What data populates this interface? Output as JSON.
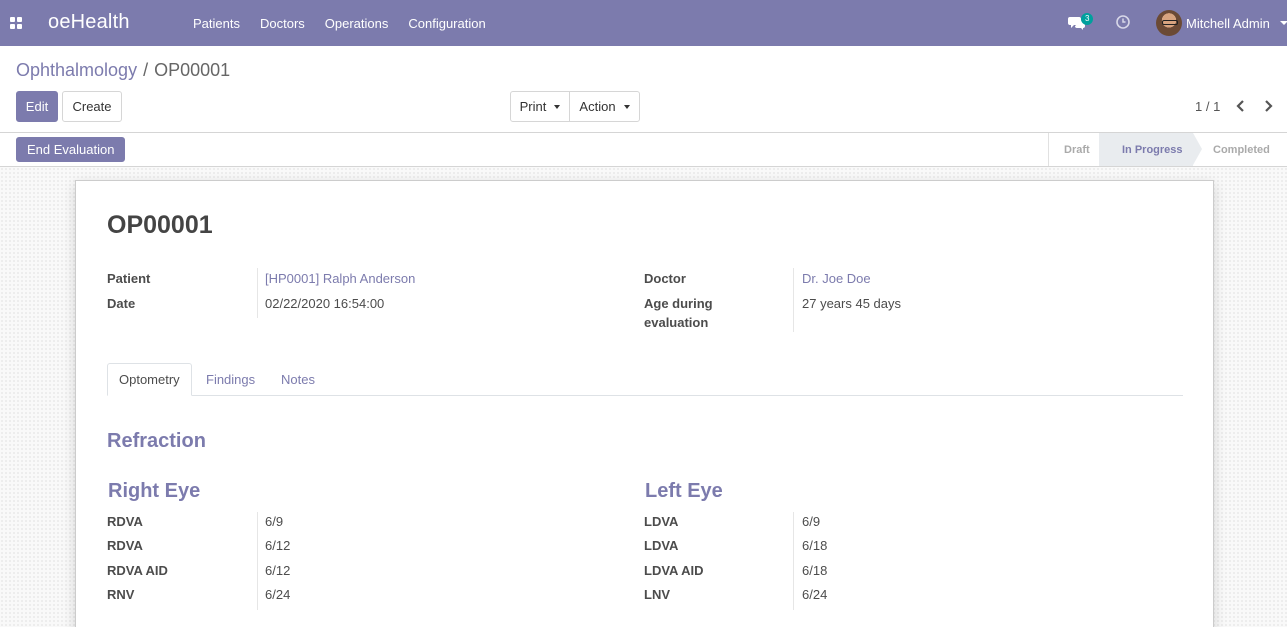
{
  "navbar": {
    "brand": "oeHealth",
    "menu": [
      "Patients",
      "Doctors",
      "Operations",
      "Configuration"
    ],
    "chat_count": "3",
    "user_name": "Mitchell Admin"
  },
  "breadcrumb": {
    "parent": "Ophthalmology",
    "separator": "/",
    "current": "OP00001"
  },
  "buttons": {
    "edit": "Edit",
    "create": "Create",
    "print": "Print",
    "action": "Action",
    "end_evaluation": "End Evaluation"
  },
  "pager": {
    "value": "1 / 1"
  },
  "stages": [
    "Draft",
    "In Progress",
    "Completed"
  ],
  "active_stage": "In Progress",
  "record": {
    "title": "OP00001",
    "fields_left": [
      {
        "label": "Patient",
        "value": "[HP0001] Ralph Anderson"
      },
      {
        "label": "Date",
        "value": "02/22/2020 16:54:00"
      }
    ],
    "fields_right": [
      {
        "label": "Doctor",
        "value": "Dr. Joe Doe"
      },
      {
        "label": "Age during",
        "label2": "evaluation",
        "value": "27 years 45 days"
      }
    ]
  },
  "tabs": [
    "Optometry",
    "Findings",
    "Notes"
  ],
  "active_tab": "Optometry",
  "optometry": {
    "section_title": "Refraction",
    "right_eye": {
      "title": "Right Eye",
      "rows": [
        {
          "label": "RDVA",
          "value": "6/9"
        },
        {
          "label": "RDVA",
          "value": "6/12"
        },
        {
          "label": "RDVA AID",
          "value": "6/12"
        },
        {
          "label": "RNV",
          "value": "6/24"
        }
      ]
    },
    "left_eye": {
      "title": "Left Eye",
      "rows": [
        {
          "label": "LDVA",
          "value": "6/9"
        },
        {
          "label": "LDVA",
          "value": "6/18"
        },
        {
          "label": "LDVA AID",
          "value": "6/18"
        },
        {
          "label": "LNV",
          "value": "6/24"
        }
      ]
    }
  },
  "colors": {
    "brand": "#7c7bad",
    "badge": "#00a09d",
    "text": "#4c4c4c"
  }
}
